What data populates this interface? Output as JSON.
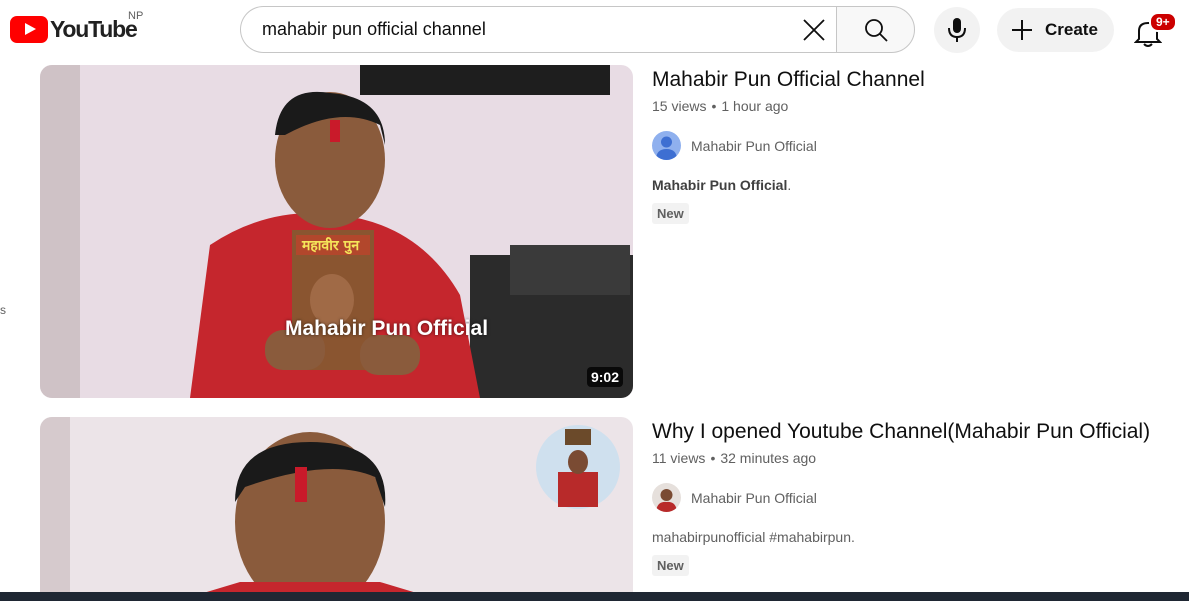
{
  "header": {
    "logo_text": "YouTube",
    "region": "NP",
    "search_value": "mahabir pun official channel",
    "create_label": "Create",
    "notification_count": "9+"
  },
  "left_edge_text": "s",
  "results": [
    {
      "title": "Mahabir Pun Official Channel",
      "views": "15 views",
      "age": "1 hour ago",
      "channel": "Mahabir Pun Official",
      "description_bold": "Mahabir Pun Official",
      "description_rest": ".",
      "badge": "New",
      "duration": "9:02",
      "thumb_overlay": "Mahabir Pun Official",
      "book_title": "महावीर पुन"
    },
    {
      "title": "Why I opened Youtube Channel(Mahabir Pun Official)",
      "views": "11 views",
      "age": "32 minutes ago",
      "channel": "Mahabir Pun Official",
      "description": "mahabirpunofficial #mahabirpun.",
      "badge": "New"
    }
  ],
  "colors": {
    "brand_red": "#ff0000",
    "badge_red": "#cc0000",
    "meta_gray": "#606060"
  }
}
